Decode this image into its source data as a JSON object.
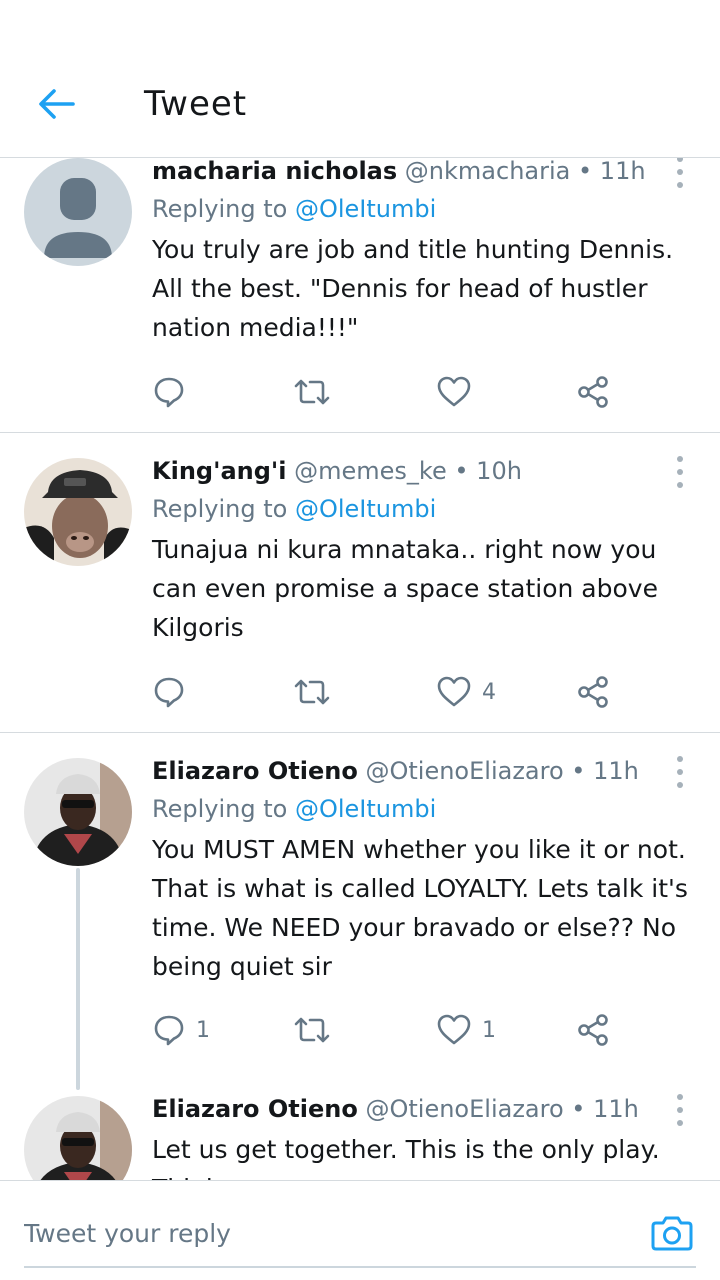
{
  "header": {
    "title": "Tweet",
    "back_icon": "arrow-left-icon",
    "accent": "#1da1f2"
  },
  "tweets": [
    {
      "name": "macharia nicholas",
      "handle": "@nkmacharia",
      "sep": "•",
      "time": "11h",
      "reply_prefix": "Replying to",
      "reply_handle": "@OleItumbi",
      "text": "You truly are job and title hunting Dennis. All the best. \"Dennis for head of hustler nation media!!!\"",
      "reply_count": "",
      "retweet_count": "",
      "like_count": ""
    },
    {
      "name": "King'ang'i",
      "handle": "@memes_ke",
      "sep": "•",
      "time": "10h",
      "reply_prefix": "Replying to",
      "reply_handle": "@OleItumbi",
      "text": "Tunajua ni kura mnataka.. right now you can even promise a space station above Kilgoris",
      "reply_count": "",
      "retweet_count": "",
      "like_count": "4"
    },
    {
      "name": "Eliazaro Otieno",
      "handle": "@OtienoEliazaro",
      "sep": "•",
      "time": "11h",
      "reply_prefix": "Replying to",
      "reply_handle": "@OleItumbi",
      "text": "You MUST AMEN whether you like it or not. That is what is called LOYALTY. Lets talk it's time. We NEED your bravado or else?? No being quiet sir",
      "reply_count": "1",
      "retweet_count": "",
      "like_count": "1"
    },
    {
      "name": "Eliazaro Otieno",
      "handle": "@OtienoEliazaro",
      "sep": "•",
      "time": "11h",
      "text": "Let us get together. This is the only play. Think"
    }
  ],
  "composer": {
    "placeholder": "Tweet your reply",
    "camera_icon": "camera-icon"
  },
  "colors": {
    "link": "#1b95e0",
    "muted": "#657786",
    "divider": "#d6dbdf",
    "text": "#14171a"
  }
}
